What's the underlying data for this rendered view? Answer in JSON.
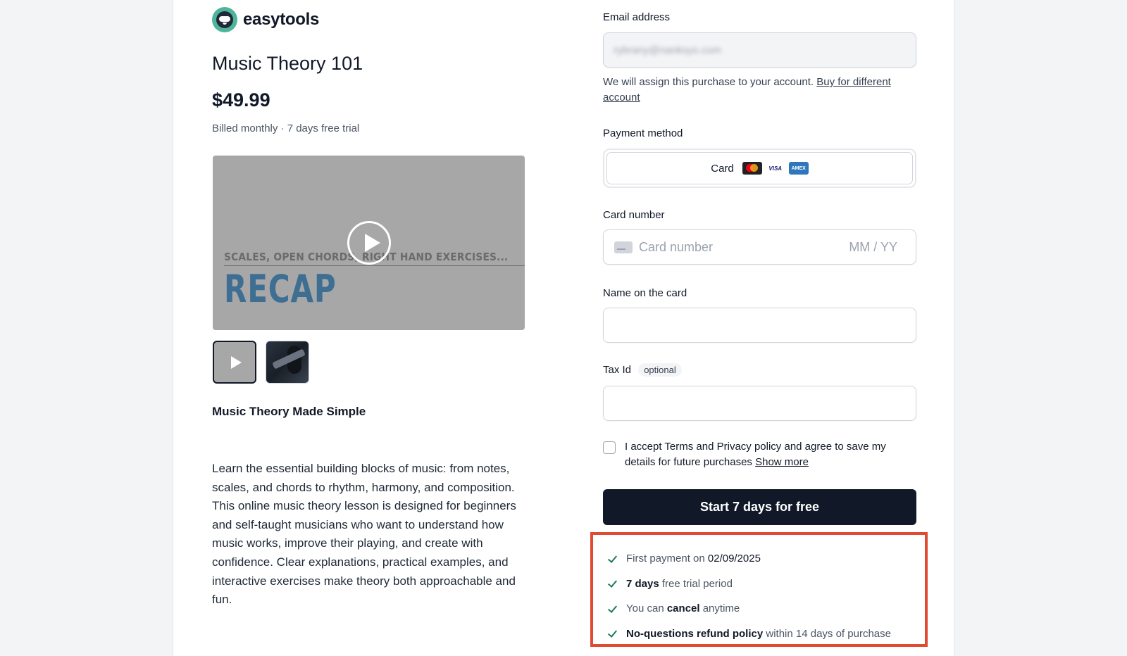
{
  "brand": {
    "name": "easytools"
  },
  "product": {
    "title": "Music Theory 101",
    "price": "$49.99",
    "billing": "Billed monthly · 7 days free trial",
    "video": {
      "overlay_top": "SCALES, OPEN CHORDS, RIGHT HAND EXERCISES...",
      "overlay_big": "RECAP"
    },
    "subtitle": "Music Theory Made Simple",
    "description": "Learn the essential building blocks of music: from notes, scales, and chords to rhythm, harmony, and composition. This online music theory lesson is designed for beginners and self-taught musicians who want to understand how music works, improve their playing, and create with confidence. Clear explanations, practical examples, and interactive exercises make theory both approachable and fun."
  },
  "checkout": {
    "email_label": "Email address",
    "email_value": "rybrany@nanksys.com",
    "assign_text": "We will assign this purchase to your account.",
    "assign_link": "Buy for different account",
    "payment_label": "Payment method",
    "payment_option": "Card",
    "visa_label": "VISA",
    "amex_label": "AMEX",
    "card_number_label": "Card number",
    "card_number_placeholder": "Card number",
    "expiry_placeholder": "MM / YY",
    "name_label": "Name on the card",
    "tax_label": "Tax Id",
    "tax_optional": "optional",
    "terms_text": "I accept Terms and Privacy policy and agree to save my details for future purchases",
    "terms_link": "Show more",
    "cta": "Start 7 days for free"
  },
  "benefits": [
    {
      "pre": "First payment on",
      "strong": "02/09/2025",
      "post": ""
    },
    {
      "pre": "",
      "strong": "7 days",
      "post": "free trial period"
    },
    {
      "pre": "You can",
      "strong": "cancel",
      "post": "anytime"
    },
    {
      "pre": "",
      "strong": "No-questions refund policy",
      "post": "within 14 days of purchase"
    }
  ],
  "colors": {
    "accent": "#111827",
    "highlight_border": "#e04a32",
    "brand_green": "#4fb59a",
    "check": "#1f7a5a"
  }
}
